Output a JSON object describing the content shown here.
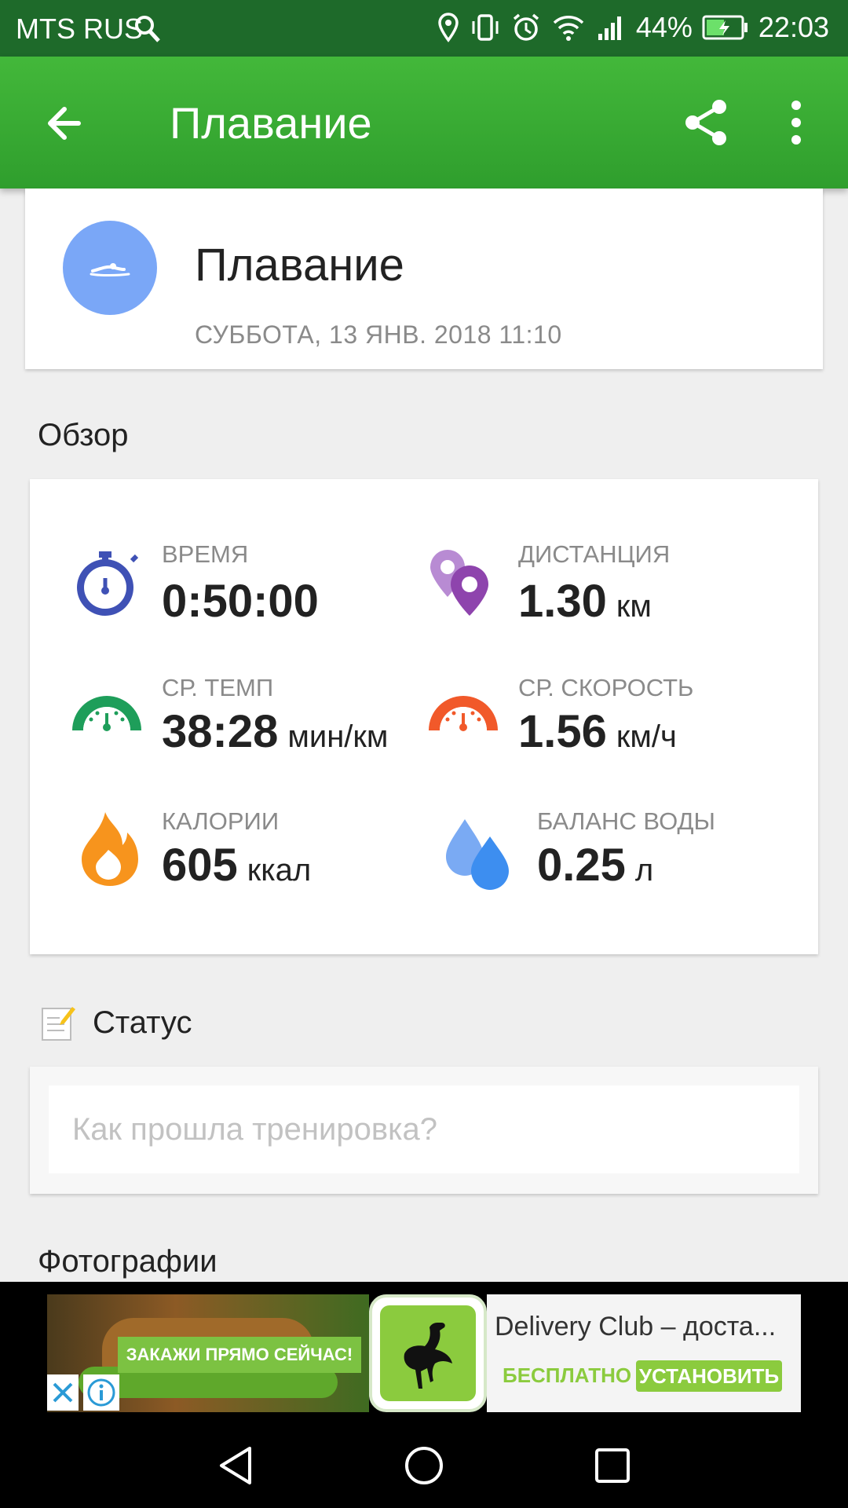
{
  "status_bar": {
    "carrier": "MTS RUS",
    "battery_percent": "44%",
    "time": "22:03",
    "icons": [
      "search-icon",
      "location-icon",
      "vibrate-icon",
      "alarm-icon",
      "wifi-icon",
      "signal-icon",
      "battery-charging-icon"
    ]
  },
  "app_bar": {
    "title": "Плавание",
    "background": "#3aaa34"
  },
  "activity": {
    "title": "Плавание",
    "datetime": "СУББОТА, 13 ЯНВ. 2018 11:10",
    "avatar_color": "#7aa7f7",
    "avatar_icon": "swimmer-icon"
  },
  "overview": {
    "title": "Обзор",
    "stats": [
      {
        "label": "ВРЕМЯ",
        "value": "0:50:00",
        "unit": "",
        "icon": "stopwatch-icon",
        "color": "#3f51b5"
      },
      {
        "label": "ДИСТАНЦИЯ",
        "value": "1.30",
        "unit": "км",
        "icon": "map-pin-icon",
        "color": "#8e44ad"
      },
      {
        "label": "СР. ТЕМП",
        "value": "38:28",
        "unit": "мин/км",
        "icon": "gauge-green-icon",
        "color": "#1e9e5a"
      },
      {
        "label": "СР. СКОРОСТЬ",
        "value": "1.56",
        "unit": "км/ч",
        "icon": "gauge-orange-icon",
        "color": "#f1592a"
      },
      {
        "label": "КАЛОРИИ",
        "value": "605",
        "unit": "ккал",
        "icon": "flame-icon",
        "color": "#f7941d"
      },
      {
        "label": "БАЛАНС ВОДЫ",
        "value": "0.25",
        "unit": "л",
        "icon": "water-drops-icon",
        "color": "#3d8ef0"
      }
    ]
  },
  "status": {
    "title": "Статус",
    "placeholder": "Как прошла тренировка?",
    "value": ""
  },
  "photos": {
    "title": "Фотографии"
  },
  "ad": {
    "banner_text": "ЗАКАЖИ ПРЯМО СЕЙЧАС!",
    "app_title": "Delivery Club – доста...",
    "free_label": "БЕСПЛАТНО",
    "install_label": "УСТАНОВИТЬ",
    "accent": "#8bcb3e"
  },
  "navigation": {
    "buttons": [
      "back-nav-icon",
      "home-nav-icon",
      "recents-nav-icon"
    ]
  }
}
